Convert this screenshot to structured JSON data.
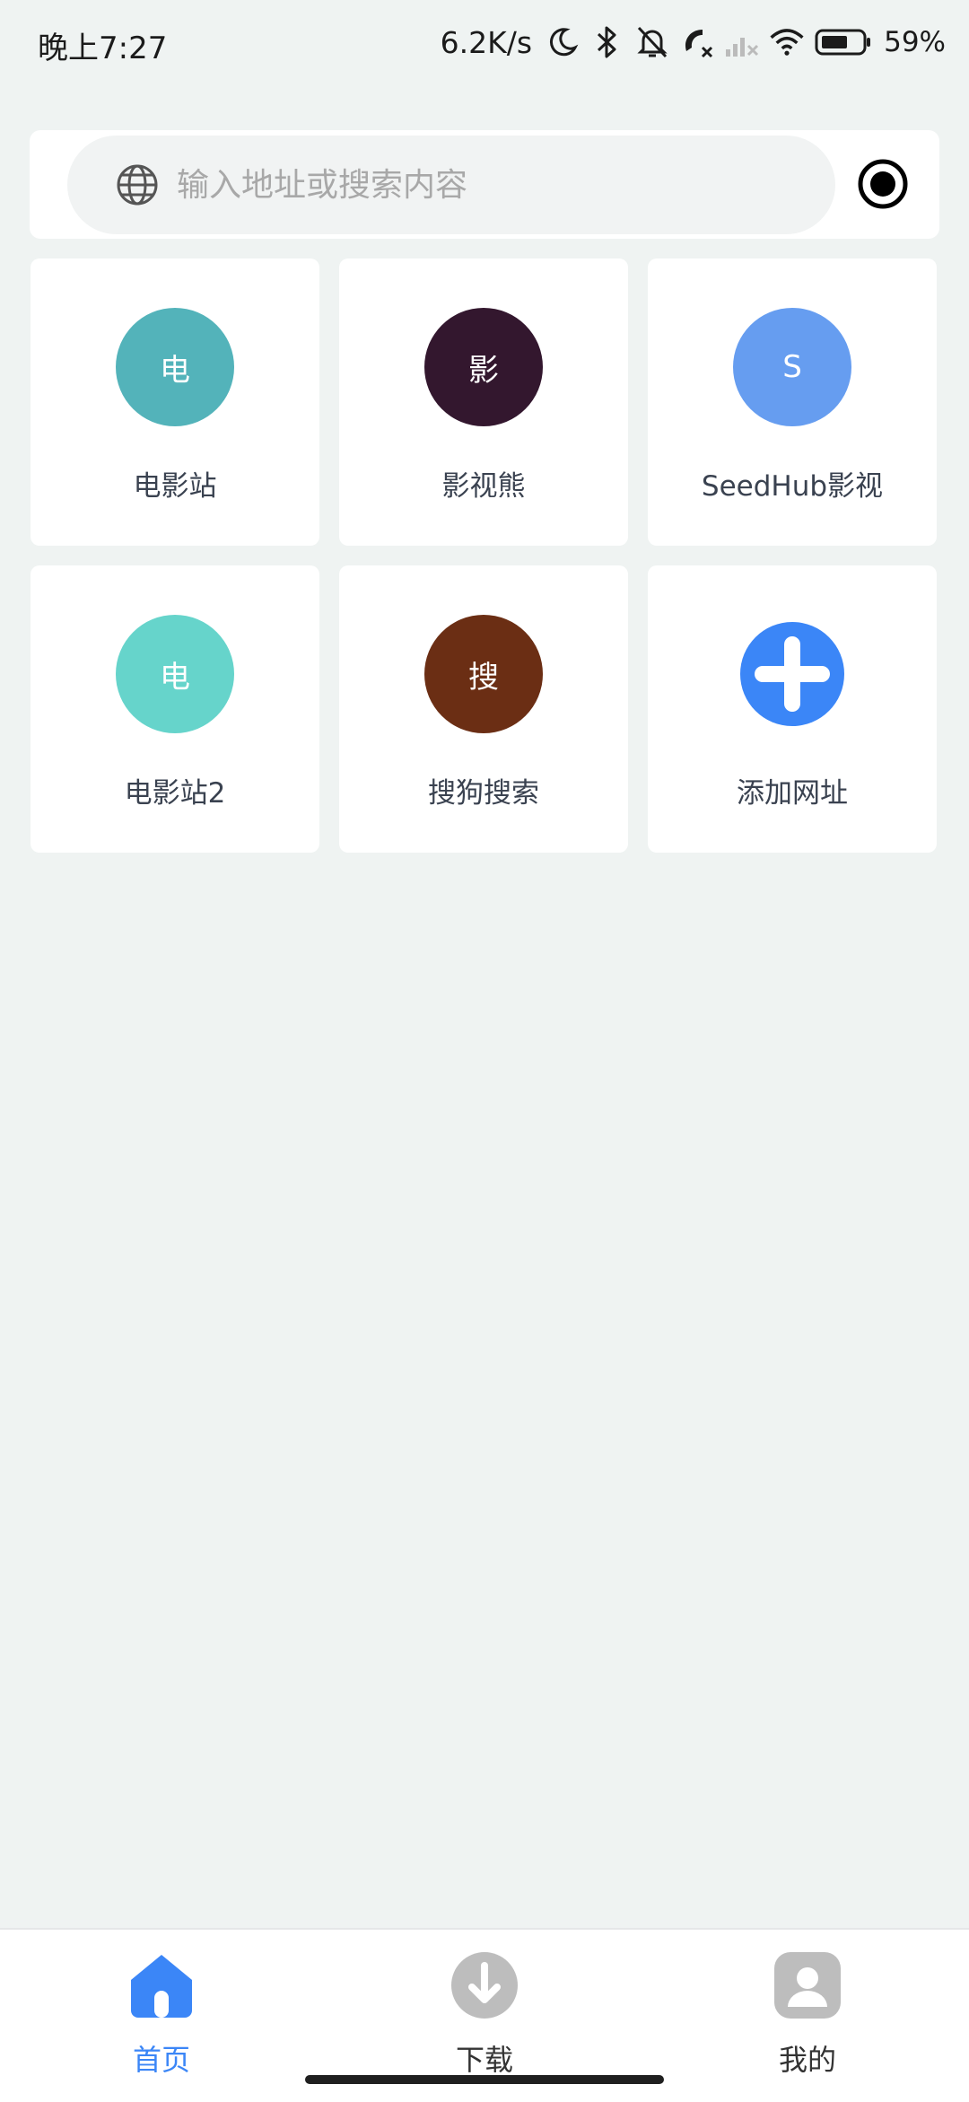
{
  "status_bar": {
    "time": "晚上7:27",
    "net_speed": "6.2K/s",
    "battery": "59%",
    "icons": [
      "moon-icon",
      "bluetooth-icon",
      "bell-off-icon",
      "call-off-icon",
      "signal-off-icon",
      "wifi-icon",
      "battery-icon"
    ]
  },
  "search": {
    "placeholder": "输入地址或搜索内容",
    "icon": "globe-icon",
    "action_icon": "record-icon"
  },
  "tiles": [
    {
      "label": "电影站",
      "glyph": "电",
      "color": "#53b3ba"
    },
    {
      "label": "影视熊",
      "glyph": "影",
      "color": "#33172e"
    },
    {
      "label": "SeedHub影视",
      "glyph": "S",
      "color": "#669df0"
    },
    {
      "label": "电影站2",
      "glyph": "电",
      "color": "#66d4cb"
    },
    {
      "label": "搜狗搜索",
      "glyph": "搜",
      "color": "#6b2e14"
    },
    {
      "label": "添加网址",
      "icon": "plus-icon",
      "color": "#3b86f7"
    }
  ],
  "bottom_nav": [
    {
      "label": "首页",
      "icon": "home-icon",
      "active": true
    },
    {
      "label": "下载",
      "icon": "download-icon",
      "active": false
    },
    {
      "label": "我的",
      "icon": "profile-icon",
      "active": false
    }
  ],
  "colors": {
    "accent": "#3b86f7",
    "background": "#eff3f2",
    "inactive_icon": "#bdbdbd"
  }
}
